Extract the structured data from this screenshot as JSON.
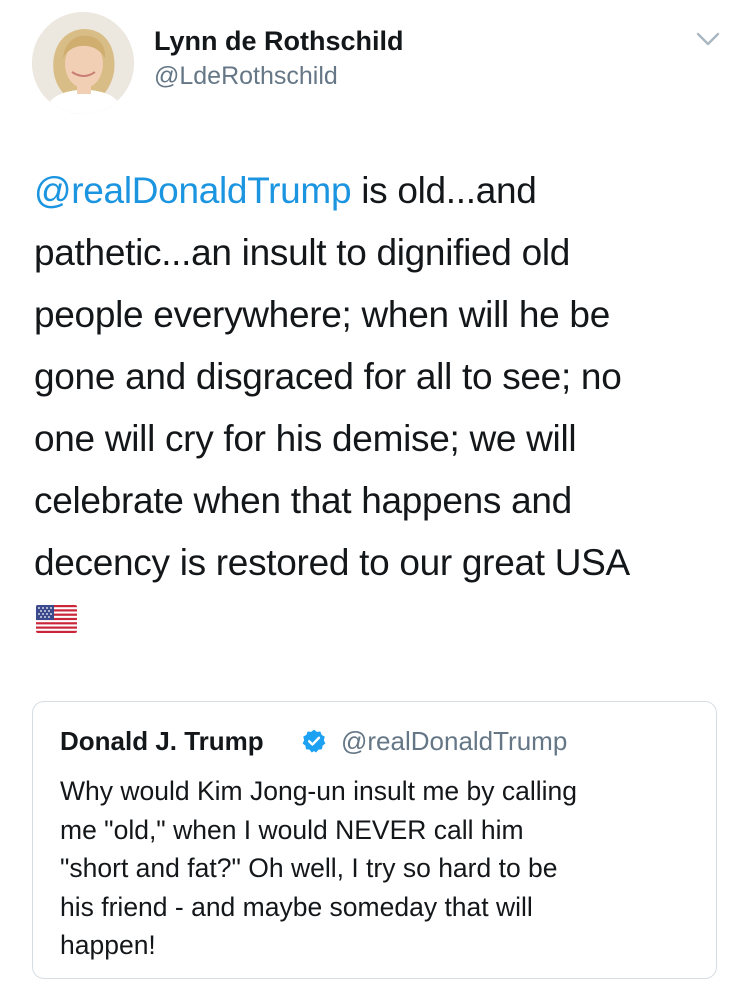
{
  "author": {
    "display_name": "Lynn de Rothschild",
    "handle": "@LdeRothschild"
  },
  "tweet": {
    "mention": "@realDonaldTrump",
    "lines": [
      " is old...and",
      "pathetic...an insult to dignified old",
      "people everywhere;  when will he be",
      "gone and disgraced for all to see; no",
      "one will cry for his demise; we will",
      "celebrate when that happens and",
      "decency is restored to our great USA"
    ],
    "emoji": "us-flag-emoji"
  },
  "quoted_tweet": {
    "display_name": "Donald J. Trump",
    "handle": "@realDonaldTrump",
    "verified": true,
    "lines": [
      "Why would Kim Jong-un insult me by calling",
      "me \"old,\" when I would NEVER call him",
      "\"short and fat?\" Oh well, I try so hard to be",
      "his friend - and maybe someday that will",
      "happen!"
    ]
  },
  "colors": {
    "link": "#1b95e0",
    "text": "#14171a",
    "secondary": "#657786",
    "border": "#d5dde3",
    "verified_badge": "#1da1f2"
  },
  "icons": [
    "chevron-down-icon",
    "verified-badge-icon"
  ]
}
